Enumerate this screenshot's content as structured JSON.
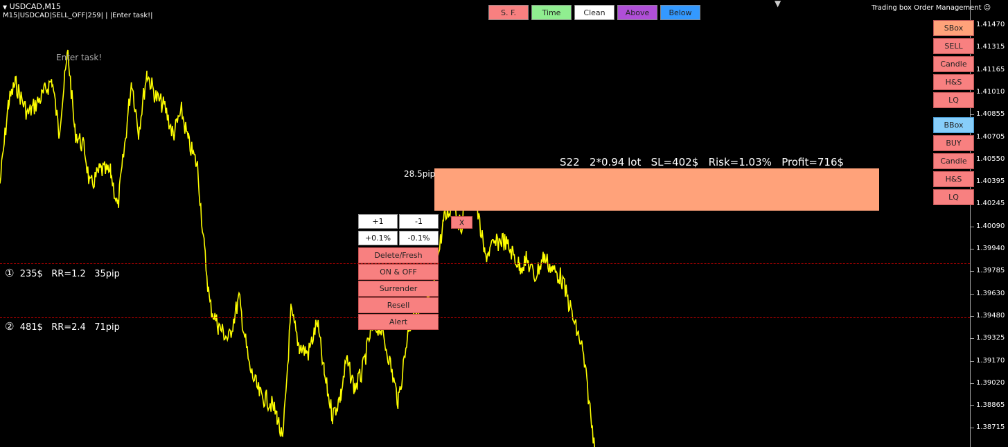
{
  "header": {
    "symbol": "USDCAD,M15",
    "info_line": "M15|USDCAD|SELL_OFF|259| | |Enter task!|",
    "brand": "Trading box Order Management"
  },
  "chart_task_label": "Enter task!",
  "toolbar": [
    {
      "label": "S. F.",
      "color": "#f88080"
    },
    {
      "label": "Time",
      "color": "#90ee90"
    },
    {
      "label": "Clean",
      "color": "#ffffff"
    },
    {
      "label": "Above",
      "color": "#b04fd8"
    },
    {
      "label": "Below",
      "color": "#3399ff"
    }
  ],
  "sell_panel": [
    "SBox",
    "SELL",
    "Candle",
    "H&S",
    "LQ"
  ],
  "buy_panel": [
    "BBox",
    "BUY",
    "Candle",
    "H&S",
    "LQ"
  ],
  "colors": {
    "line": "#ffff00",
    "sbox": "#ffa27a",
    "sell_btn": "#f88080",
    "bbox": "#87cefa",
    "level_line": "#c00000",
    "background": "#000000"
  },
  "price_axis": [
    "1.41470",
    "1.41315",
    "1.41165",
    "1.41010",
    "1.40855",
    "1.40705",
    "1.40550",
    "1.40395",
    "1.40245",
    "1.40090",
    "1.39940",
    "1.39785",
    "1.39630",
    "1.39480",
    "1.39325",
    "1.39170",
    "1.39020",
    "1.38865",
    "1.38715"
  ],
  "order_box": {
    "summary": "S22   2*0.94 lot   SL=402$   Risk=1.03%   Profit=716$",
    "pip_label": "28.5pip",
    "close_label": "X"
  },
  "levels": [
    {
      "marker": "①",
      "text": "235$   RR=1.2   35pip"
    },
    {
      "marker": "②",
      "text": "481$   RR=2.4   71pip"
    }
  ],
  "control_panel": {
    "plus1": "+1",
    "minus1": "-1",
    "plus01": "+0.1%",
    "minus01": "-0.1%",
    "actions": [
      "Delete/Fresh",
      "ON & OFF",
      "Surrender",
      "Resell",
      "Alert"
    ]
  }
}
